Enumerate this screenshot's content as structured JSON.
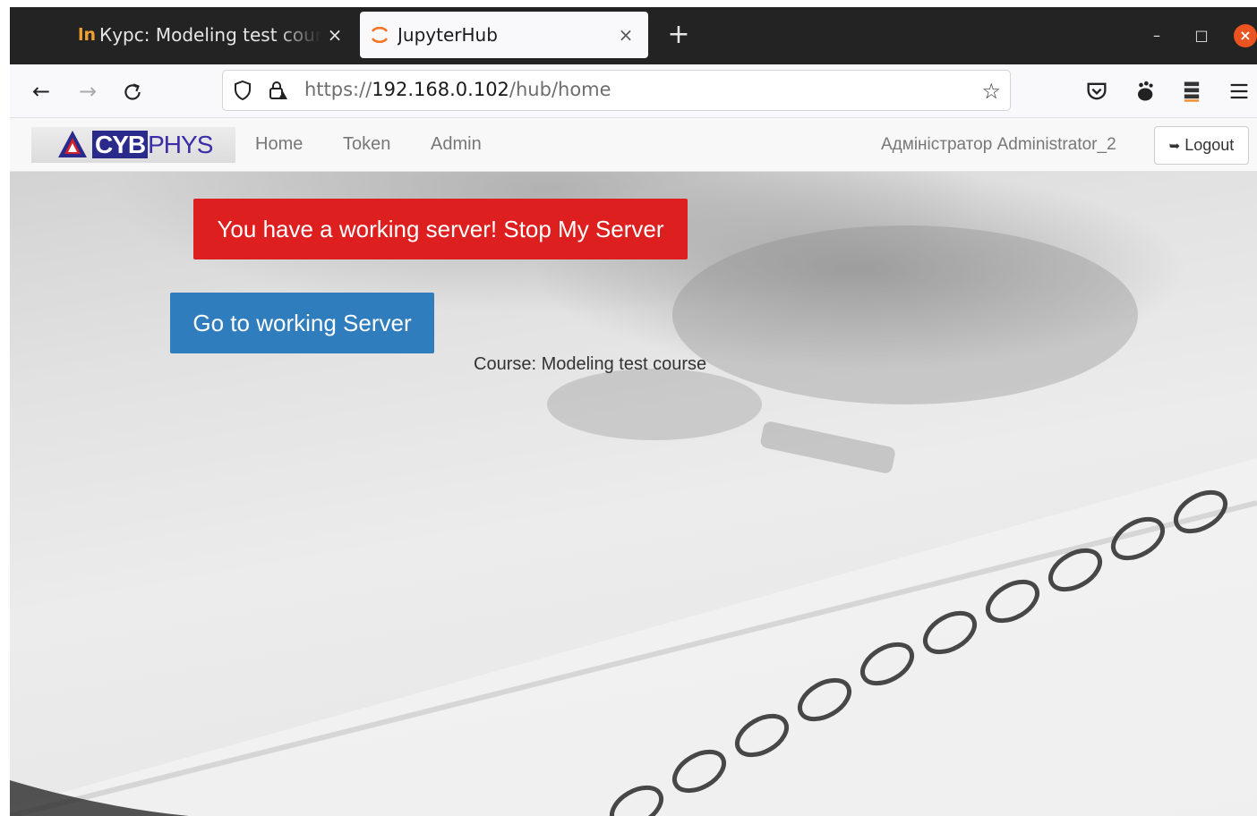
{
  "browser": {
    "tabs": [
      {
        "title": "Курс: Modeling test cours",
        "favicon": "ln-logo-icon",
        "close": "×",
        "active": false
      },
      {
        "title": "JupyterHub",
        "favicon": "jupyter-icon",
        "close": "×",
        "active": true
      }
    ],
    "new_tab": "+",
    "window": {
      "minimize": "–",
      "maximize": "□",
      "close": "×"
    },
    "nav": {
      "back": "←",
      "forward": "→",
      "reload": "C"
    },
    "url": {
      "scheme": "https://",
      "host": "192.168.0.102",
      "path": "/hub/home"
    },
    "star": "☆"
  },
  "header": {
    "logo_text_a": "CYB",
    "logo_text_b": "PHYS",
    "menu": [
      {
        "label": "Home"
      },
      {
        "label": "Token"
      },
      {
        "label": "Admin"
      }
    ],
    "user": "Адміністратор Administrator_2",
    "logout_icon": "➥",
    "logout": "Logout"
  },
  "main": {
    "stop_button": "You have a working server! Stop My Server",
    "goto_button": "Go to working Server",
    "course": "Course: Modeling test course"
  },
  "colors": {
    "stop": "#dd1f1f",
    "goto": "#2f7dbd",
    "tabbar": "#232323",
    "close_window": "#e95420"
  }
}
